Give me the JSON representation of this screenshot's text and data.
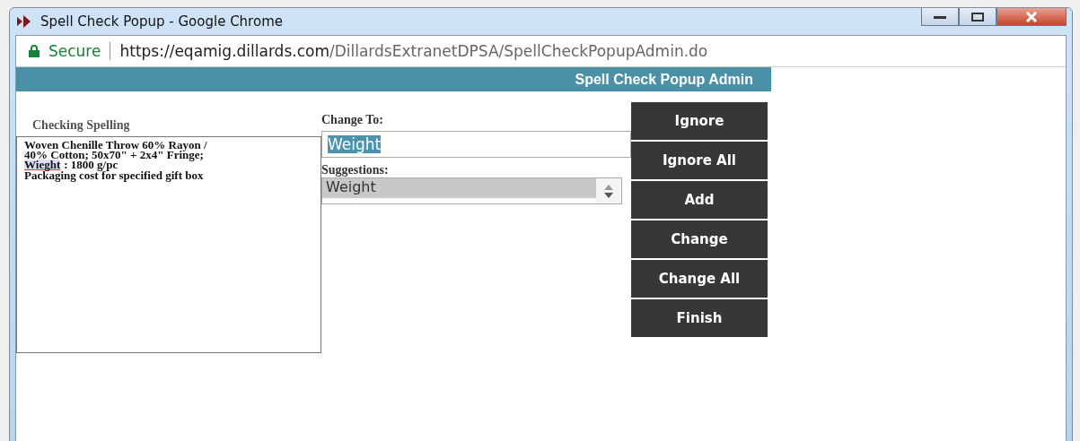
{
  "window": {
    "title": "Spell Check Popup - Google Chrome"
  },
  "address_bar": {
    "security": "Secure",
    "url_host": "https://eqamig.dillards.com",
    "url_path": "/DillardsExtranetDPSA/SpellCheckPopupAdmin.do"
  },
  "header": {
    "title": "Spell Check Popup Admin"
  },
  "checking": {
    "label": "Checking Spelling",
    "lines": [
      {
        "kind": "plain",
        "text": "Woven Chenille Throw 60% Rayon /"
      },
      {
        "kind": "plain",
        "text": "40% Cotton; 50x70\" + 2x4\" Fringe;"
      },
      {
        "kind": "flagged",
        "word": "Wieght",
        "rest": ": 1800 g/pc"
      },
      {
        "kind": "plain",
        "text": "Packaging cost for specified gift box"
      }
    ]
  },
  "change_to": {
    "label": "Change To:",
    "value": "Weight"
  },
  "suggestions": {
    "label": "Suggestions:",
    "items": [
      {
        "label": "Weight",
        "selected": true
      }
    ]
  },
  "buttons": [
    "Ignore",
    "Ignore All",
    "Add",
    "Change",
    "Change All",
    "Finish"
  ]
}
